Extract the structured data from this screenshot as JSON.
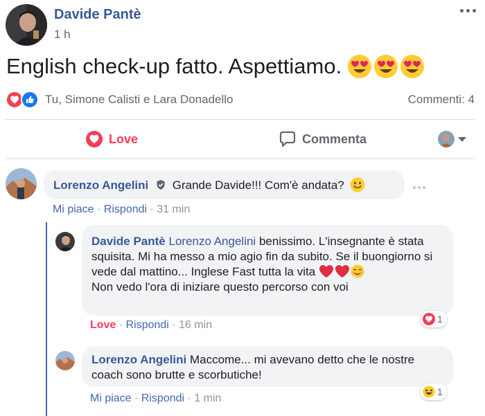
{
  "post": {
    "author": "Davide Pantè",
    "time": "1 h",
    "text": "English check-up fatto. Aspettiamo.",
    "reactors": "Tu, Simone Calisti e Lara Donadello",
    "comments_count": "Commenti: 4"
  },
  "actions": {
    "love_label": "Love",
    "comment_label": "Commenta"
  },
  "comments": [
    {
      "author": "Lorenzo Angelini",
      "text": "Grande Davide!!! Com'è andata?",
      "like_label": "Mi piace",
      "reply_label": "Rispondi",
      "time": "31 min"
    },
    {
      "author": "Davide Pantè",
      "mention": "Lorenzo Angelini",
      "text_line1": "benissimo. L'insegnante è stata squisita. Mi ha messo a mio agio fin da subito. Se il buongiorno si vede dal mattino... Inglese Fast tutta la vita",
      "text_line2": "Non vedo l'ora di iniziare questo percorso con voi",
      "like_label": "Love",
      "reply_label": "Rispondi",
      "time": "16 min",
      "reaction_count": "1"
    },
    {
      "author": "Lorenzo Angelini",
      "text": "Maccome... mi avevano detto che le nostre coach sono brutte e scorbutiche!",
      "like_label": "Mi piace",
      "reply_label": "Rispondi",
      "time": "1 min",
      "reaction_count": "1"
    }
  ],
  "colors": {
    "link": "#385898",
    "love": "#f33e58",
    "thread_line": "#4267b2",
    "bubble": "#f2f3f5"
  },
  "icons": [
    "more-horizontal-icon",
    "heart-eyes-emoji-icon",
    "love-reaction-icon",
    "like-reaction-icon",
    "love-outline-icon",
    "comment-icon",
    "caret-down-icon",
    "verified-badge-icon",
    "smiley-emoji-icon",
    "red-heart-emoji-icon",
    "smiling-emoji-icon",
    "laughing-emoji-icon"
  ]
}
